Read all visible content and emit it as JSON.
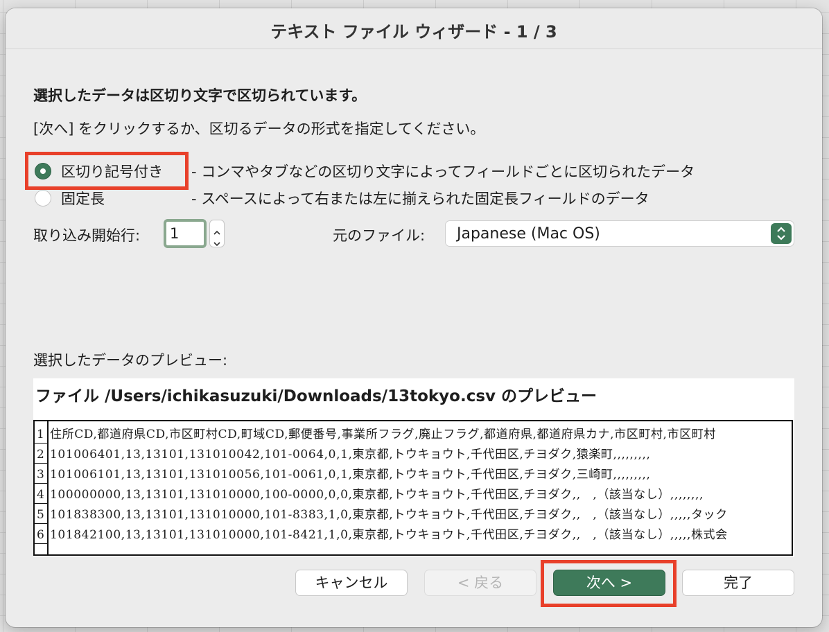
{
  "dialog": {
    "title": "テキスト ファイル ウィザード - 1 / 3"
  },
  "intro": {
    "heading": "選択したデータは区切り文字で区切られています。",
    "instruction": "[次へ] をクリックするか、区切るデータの形式を指定してください。"
  },
  "format_options": [
    {
      "label": "区切り記号付き",
      "description": "- コンマやタブなどの区切り文字によってフィールドごとに区切られたデータ",
      "selected": true
    },
    {
      "label": "固定長",
      "description": "- スペースによって右または左に揃えられた固定長フィールドのデータ",
      "selected": false
    }
  ],
  "import_start": {
    "label": "取り込み開始行:",
    "value": "1"
  },
  "source_file": {
    "label": "元のファイル:",
    "value": "Japanese (Mac OS)"
  },
  "preview": {
    "label": "選択したデータのプレビュー:",
    "title": "ファイル /Users/ichikasuzuki/Downloads/13tokyo.csv のプレビュー",
    "rows": [
      {
        "num": "1",
        "text": "住所CD,都道府県CD,市区町村CD,町域CD,郵便番号,事業所フラグ,廃止フラグ,都道府県,都道府県カナ,市区町村,市区町村"
      },
      {
        "num": "2",
        "text": "101006401,13,13101,131010042,101-0064,0,1,東京都,トウキョウト,千代田区,チヨダク,猿楽町,,,,,,,,,"
      },
      {
        "num": "3",
        "text": "101006101,13,13101,131010056,101-0061,0,1,東京都,トウキョウト,千代田区,チヨダク,三崎町,,,,,,,,,"
      },
      {
        "num": "4",
        "text": "100000000,13,13101,131010000,100-0000,0,0,東京都,トウキョウト,千代田区,チヨダク,,　,（該当なし）,,,,,,,,"
      },
      {
        "num": "5",
        "text": "101838300,13,13101,131010000,101-8383,1,0,東京都,トウキョウト,千代田区,チヨダク,,　,（該当なし）,,,,,タック"
      },
      {
        "num": "6",
        "text": "101842100,13,13101,131010000,101-8421,1,0,東京都,トウキョウト,千代田区,チヨダク,,　,（該当なし）,,,,,株式会"
      }
    ]
  },
  "buttons": {
    "cancel": "キャンセル",
    "back": "< 戻る",
    "next": "次へ >",
    "finish": "完了"
  },
  "colors": {
    "accent": "#3e7a5a",
    "highlight": "#e8402a"
  }
}
